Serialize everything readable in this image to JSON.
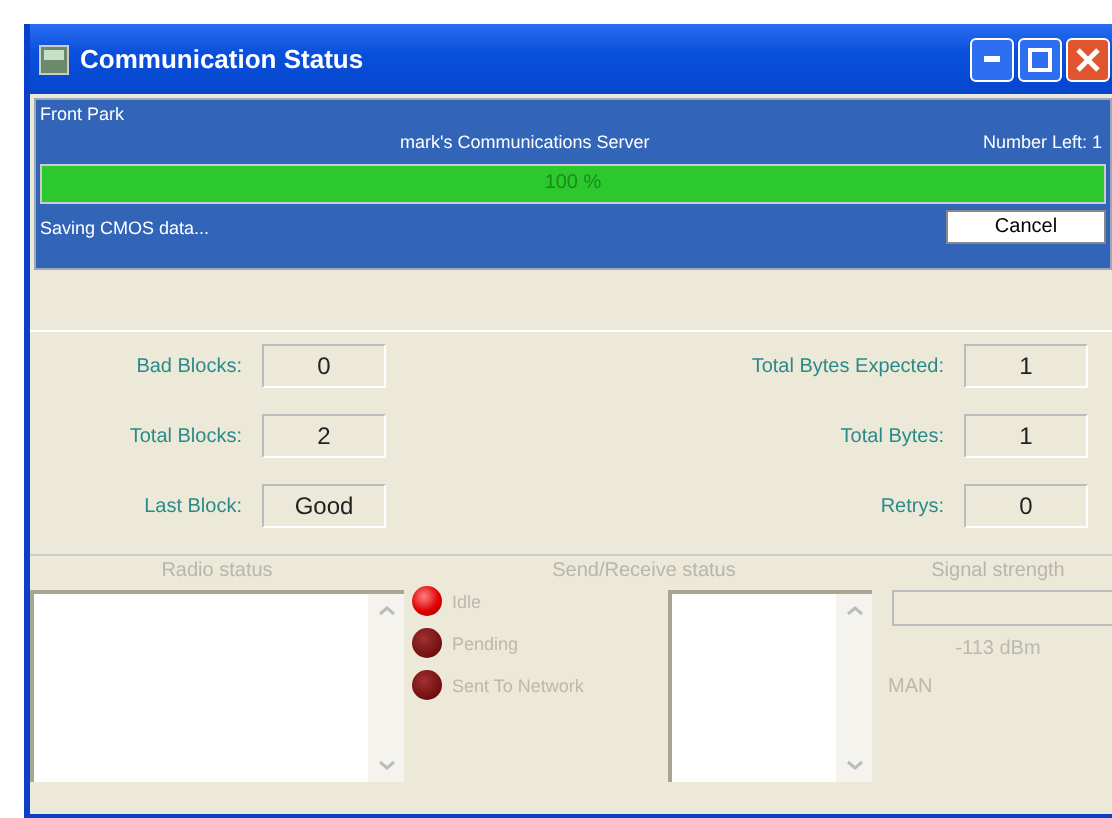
{
  "window": {
    "title": "Communication Status"
  },
  "header": {
    "location": "Front Park",
    "server": "mark's Communications Server",
    "number_left": "Number Left: 1"
  },
  "progress": {
    "level": 1,
    "label": "100 %"
  },
  "status": {
    "message": "Saving CMOS data...",
    "button": "Cancel"
  },
  "fields_left": [
    {
      "label": "Bad Blocks:",
      "value": "0"
    },
    {
      "label": "Total Blocks:",
      "value": "2"
    },
    {
      "label": "Last Block:",
      "value": "Good"
    }
  ],
  "fields_right": [
    {
      "label": "Total Bytes Expected:",
      "value": "1"
    },
    {
      "label": "Total Bytes:",
      "value": "1"
    },
    {
      "label": "Retrys:",
      "value": "0"
    }
  ],
  "radio_status": {
    "title": "Radio status"
  },
  "send_receive": {
    "title": "Send/Receive status",
    "lights": [
      {
        "label": "Idle",
        "on": true
      },
      {
        "label": "Pending",
        "on": false
      },
      {
        "label": "Sent To Network",
        "on": false
      }
    ]
  },
  "signal": {
    "title": "Signal strength",
    "reading": "-113 dBm",
    "mode": "MAN"
  }
}
